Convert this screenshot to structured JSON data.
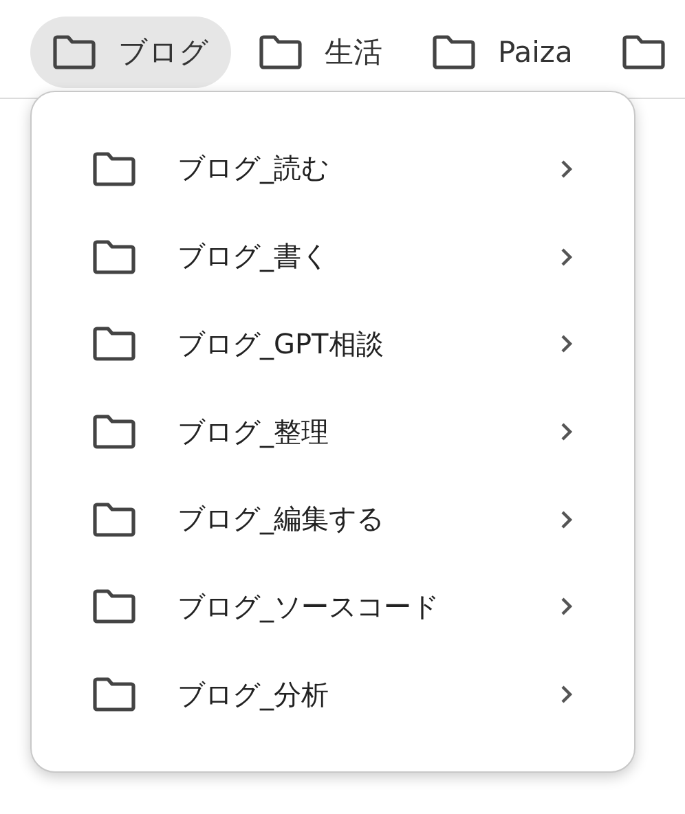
{
  "bookmarks_bar": [
    {
      "label": "ブログ",
      "selected": true
    },
    {
      "label": "生活",
      "selected": false
    },
    {
      "label": "Paiza",
      "selected": false
    },
    {
      "selected": false
    }
  ],
  "folder_menu": {
    "items": [
      {
        "label": "ブログ_読む"
      },
      {
        "label": "ブログ_書く"
      },
      {
        "label": "ブログ_GPT相談"
      },
      {
        "label": "ブログ_整理"
      },
      {
        "label": "ブログ_編集する"
      },
      {
        "label": "ブログ_ソースコード"
      },
      {
        "label": "ブログ_分析"
      }
    ]
  }
}
